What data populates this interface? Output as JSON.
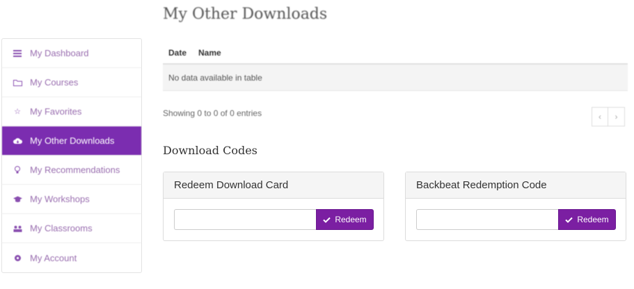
{
  "sidebar": {
    "items": [
      {
        "label": "My Dashboard",
        "icon": "dashboard-icon"
      },
      {
        "label": "My Courses",
        "icon": "folder-icon"
      },
      {
        "label": "My Favorites",
        "icon": "star-icon"
      },
      {
        "label": "My Other Downloads",
        "icon": "cloud-download-icon",
        "active": true
      },
      {
        "label": "My Recommendations",
        "icon": "lightbulb-icon"
      },
      {
        "label": "My Workshops",
        "icon": "graduation-cap-icon"
      },
      {
        "label": "My Classrooms",
        "icon": "group-icon"
      },
      {
        "label": "My Account",
        "icon": "gear-icon"
      }
    ]
  },
  "main": {
    "title": "My Other Downloads",
    "table": {
      "headers": [
        "Date",
        "Name"
      ],
      "empty_text": "No data available in table"
    },
    "info_text": "Showing 0 to 0 of 0 entries",
    "pager": {
      "prev": "‹",
      "next": "›"
    },
    "codes_title": "Download Codes",
    "cards": [
      {
        "title": "Redeem Download Card",
        "input_value": "",
        "button_label": "Redeem"
      },
      {
        "title": "Backbeat Redemption Code",
        "input_value": "",
        "button_label": "Redeem"
      }
    ]
  },
  "colors": {
    "accent": "#7b1fa2",
    "sidebar_active": "#7b2db0"
  }
}
